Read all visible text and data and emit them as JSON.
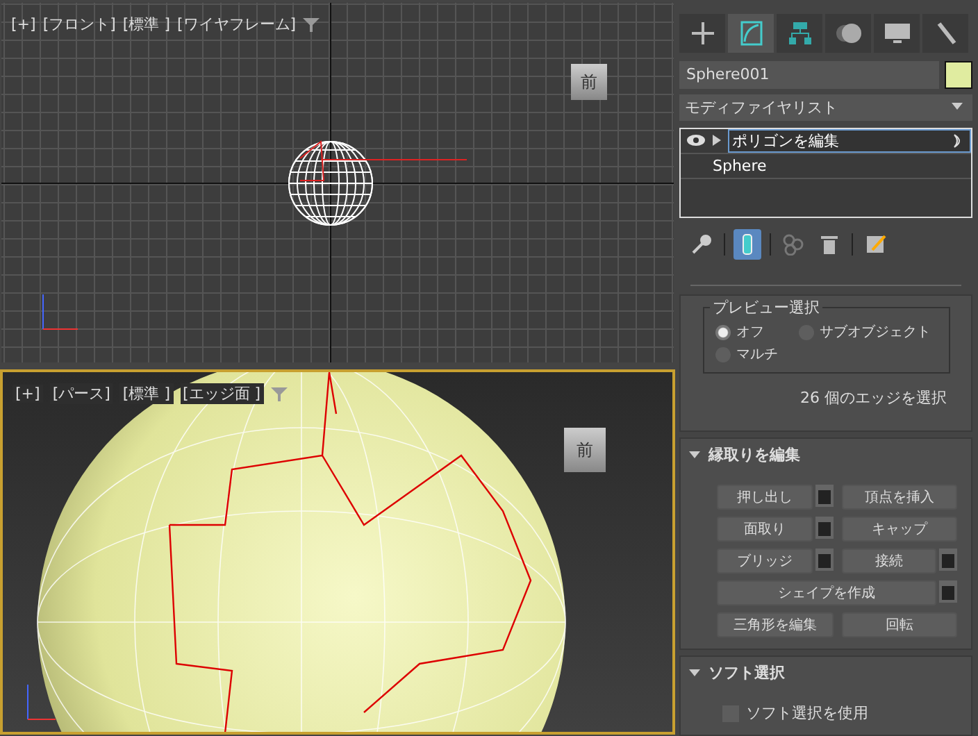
{
  "viewports": [
    {
      "kind": "wire",
      "active": false,
      "labels": [
        "[+]",
        "[フロント]",
        "[標準 ]",
        "[ワイヤフレーム]"
      ],
      "cube_label": "前"
    },
    {
      "kind": "shaded",
      "active": true,
      "labels": [
        "[+]",
        "[パース]",
        "[標準 ]",
        "[エッジ面 ]"
      ],
      "cube_label": "前"
    }
  ],
  "command_tabs": [
    {
      "kind": "create",
      "selected": false
    },
    {
      "kind": "modify",
      "selected": true
    },
    {
      "kind": "hierarchy",
      "selected": false
    },
    {
      "kind": "motion",
      "selected": false
    },
    {
      "kind": "display",
      "selected": false
    },
    {
      "kind": "utilities",
      "selected": false
    }
  ],
  "object_name": "Sphere001",
  "modifier_list": "モディファイヤリスト",
  "stack": [
    {
      "kind": "modifier",
      "label": "ポリゴンを編集",
      "selected": true
    },
    {
      "kind": "base",
      "label": "Sphere",
      "selected": false
    }
  ],
  "stack_tools": [
    {
      "kind": "pin",
      "selected": false
    },
    {
      "kind": "show-result",
      "selected": true
    },
    {
      "kind": "unique",
      "selected": false
    },
    {
      "kind": "remove",
      "selected": false
    },
    {
      "kind": "configure",
      "selected": false
    }
  ],
  "preview": {
    "title": "プレビュー選択",
    "options": [
      {
        "label": "オフ",
        "selected": true
      },
      {
        "label": "サブオブジェクト",
        "selected": false
      },
      {
        "label": "マルチ",
        "selected": false
      }
    ]
  },
  "selection_info": "26 個のエッジを選択",
  "rollouts": [
    {
      "kind": "buttons",
      "title": "縁取りを編集",
      "expanded": true,
      "buttons": [
        {
          "label": "押し出し",
          "wide": false,
          "settings": true
        },
        {
          "label": "頂点を挿入",
          "wide": false,
          "settings": false
        },
        {
          "label": "面取り",
          "wide": false,
          "settings": true
        },
        {
          "label": "キャップ",
          "wide": false,
          "settings": false
        },
        {
          "label": "ブリッジ",
          "wide": false,
          "settings": true
        },
        {
          "label": "接続",
          "wide": false,
          "settings": true
        },
        {
          "label": "シェイプを作成",
          "wide": true,
          "settings": true
        },
        {
          "label": "三角形を編集",
          "wide": false,
          "settings": false
        },
        {
          "label": "回転",
          "wide": false,
          "settings": false
        }
      ]
    },
    {
      "kind": "checkbox",
      "title": "ソフト選択",
      "expanded": true,
      "checkbox": {
        "label": "ソフト選択を使用",
        "checked": false
      }
    }
  ]
}
